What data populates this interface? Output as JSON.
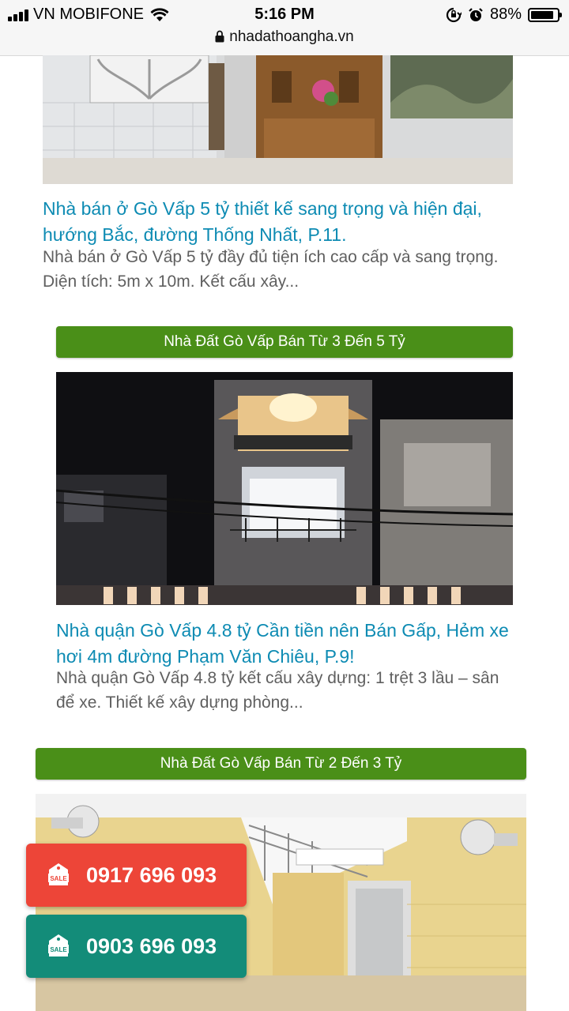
{
  "status_bar": {
    "carrier": "VN MOBIFONE",
    "time": "5:16 PM",
    "battery": "88%",
    "battery_level": 0.88,
    "url": "nhadathoangha.vn"
  },
  "posts": [
    {
      "title": "Nhà bán ở Gò Vấp 5 tỷ thiết kế sang trọng và hiện đại, hướng Bắc, đường Thống Nhất, P.11.",
      "excerpt": "Nhà bán ở Gò Vấp 5 tỷ đầy đủ tiện ích cao cấp và sang trọng. Diện tích: 5m x 10m. Kết cấu xây..."
    },
    {
      "category": "Nhà Đất Gò Vấp Bán Từ 3 Đến 5 Tỷ",
      "title": "Nhà quận Gò Vấp 4.8 tỷ Cần tiền nên Bán Gấp, Hẻm xe hơi 4m đường Phạm Văn Chiêu, P.9!",
      "excerpt": "Nhà quận Gò Vấp 4.8 tỷ kết cấu xây dựng: 1 trệt 3 lầu – sân để xe. Thiết kế xây dựng phòng..."
    },
    {
      "category": "Nhà Đất Gò Vấp Bán Từ 2 Đến 3 Tỷ"
    }
  ],
  "call_buttons": [
    {
      "phone": "0917 696 093",
      "icon": "sale-tag-icon",
      "color": "#ed4538"
    },
    {
      "phone": "0903 696 093",
      "icon": "sale-tag-icon",
      "color": "#138c79"
    }
  ]
}
